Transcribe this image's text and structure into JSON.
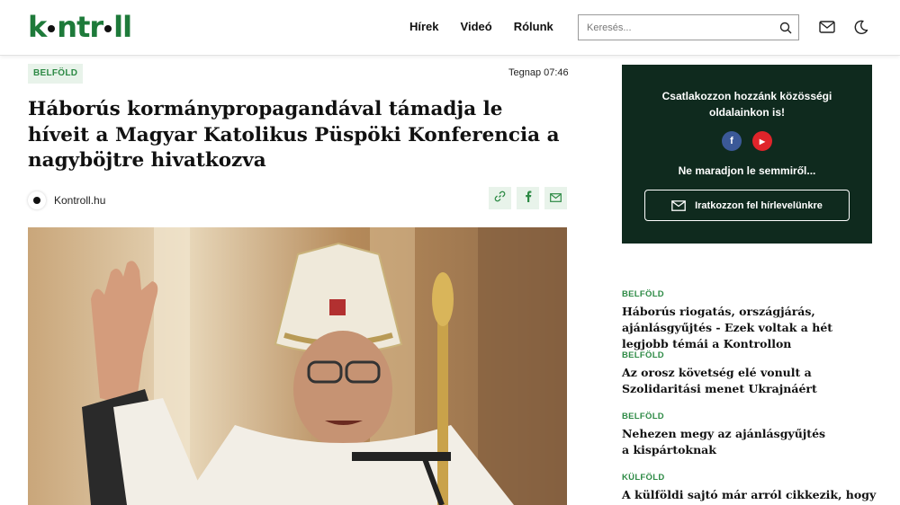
{
  "header": {
    "logo": {
      "part1": "k",
      "part2": "ntr",
      "part3": "ll"
    },
    "nav": [
      "Hírek",
      "Videó",
      "Rólunk"
    ],
    "search_placeholder": "Keresés...",
    "icons": [
      "search-icon",
      "mail-icon",
      "moon-icon"
    ]
  },
  "article": {
    "category": "BELFÖLD",
    "time": "Tegnap 07:46",
    "title": "Háborús kormánypropagandával támadja le híveit a Magyar Katolikus Püspöki Konferencia a nagyböjtre hivatkozva",
    "author": "Kontroll.hu",
    "share_icons": [
      "link-icon",
      "facebook-icon",
      "mail-icon"
    ]
  },
  "sidebar": {
    "box": {
      "line1": "Csatlakozzon hozzánk közösségi oldalainkon is!",
      "social": [
        {
          "icon": "facebook-icon",
          "glyph": "f",
          "color": "#3b5998"
        },
        {
          "icon": "youtube-icon",
          "glyph": "▶",
          "color": "#e0242a"
        }
      ],
      "line2": "Ne maradjon le semmiről...",
      "newsletter": "Iratkozzon fel hírlevelünkre"
    },
    "news": [
      {
        "category": "BELFÖLD",
        "title": "Háborús riogatás, országjárás, ajánlásgyűjtés - Ezek voltak a hét legjobb témái a Kontrollon"
      },
      {
        "category": "BELFÖLD",
        "title": "Az orosz követség elé vonult a Szolidaritási menet Ukrajnáért"
      },
      {
        "category": "BELFÖLD",
        "title": "Nehezen megy az ajánlásgyűjtés a kispártoknak"
      },
      {
        "category": "KÜLFÖLD",
        "title": "A külföldi sajtó már arról cikkezik, hogy"
      }
    ]
  },
  "colors": {
    "brand": "#1e7a3a",
    "accent_bg": "#e8f3ea",
    "sidebar_box": "#0f2a1e"
  }
}
